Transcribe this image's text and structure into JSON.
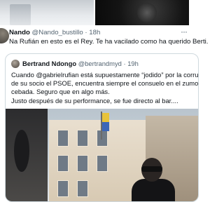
{
  "tweet": {
    "author_name": "Nando",
    "author_handle": "@Nando_bustillo",
    "time": "18h",
    "separator": "·",
    "text": "Na Rufián en esto es el Rey. Te ha vacilado como ha querido Berti.",
    "more_icon": "more-dots-icon"
  },
  "quoted_tweet": {
    "author_name": "Bertrand Ndongo",
    "author_handle": "@bertrandmyd",
    "time": "19h",
    "separator": "·",
    "text_lines": [
      "Cuando @gabrielrufian está supuestamente “jodido” por la corrupció",
      "de su socio el PSOE, encuentra siempre el consuelo en el zumo de",
      "cebada. Seguro que en algo más."
    ],
    "text_2": "Justo después de su performance, se fue directo al bar....",
    "media": "street-photo-image"
  },
  "top_media": {
    "left": "previous-media-left-image",
    "right": "previous-media-right-image"
  }
}
